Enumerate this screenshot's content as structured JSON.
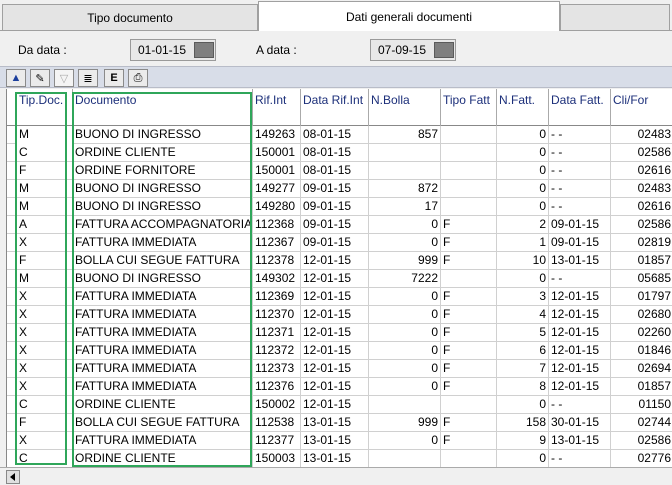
{
  "tabs": [
    {
      "label": "Tipo documento"
    },
    {
      "label": "Dati generali documenti"
    },
    {
      "label": ""
    }
  ],
  "filter": {
    "from_label": "Da data :",
    "from_value": "01-01-15",
    "to_label": "A data :",
    "to_value": "07-09-15"
  },
  "toolbar": [
    {
      "icon": "up-arrow-icon",
      "glyph": "▲"
    },
    {
      "icon": "edit-icon",
      "glyph": "✎"
    },
    {
      "icon": "filter-icon",
      "glyph": "▽"
    },
    {
      "icon": "list-icon",
      "glyph": "≣"
    },
    {
      "icon": "excel-export-icon",
      "glyph": "E"
    },
    {
      "icon": "print-icon",
      "glyph": "⎙"
    }
  ],
  "columns": [
    "Tip.Doc.",
    "Documento",
    "Rif.Int",
    "Data Rif.Int",
    "N.Bolla",
    "Tipo Fatt",
    "N.Fatt.",
    "Data Fatt.",
    "Cli/For"
  ],
  "rows": [
    [
      "M",
      "BUONO DI INGRESSO",
      "149263",
      "08-01-15",
      "857",
      "",
      "0",
      "- -",
      "02483"
    ],
    [
      "C",
      "ORDINE CLIENTE",
      "150001",
      "08-01-15",
      "",
      "",
      "0",
      "- -",
      "02586"
    ],
    [
      "F",
      "ORDINE FORNITORE",
      "150001",
      "08-01-15",
      "",
      "",
      "0",
      "- -",
      "02616"
    ],
    [
      "M",
      "BUONO DI INGRESSO",
      "149277",
      "09-01-15",
      "872",
      "",
      "0",
      "- -",
      "02483"
    ],
    [
      "M",
      "BUONO DI INGRESSO",
      "149280",
      "09-01-15",
      "17",
      "",
      "0",
      "- -",
      "02616"
    ],
    [
      "A",
      "FATTURA ACCOMPAGNATORIA",
      "112368",
      "09-01-15",
      "0",
      "F",
      "2",
      "09-01-15",
      "02586"
    ],
    [
      "X",
      "FATTURA IMMEDIATA",
      "112367",
      "09-01-15",
      "0",
      "F",
      "1",
      "09-01-15",
      "02819"
    ],
    [
      "F",
      "BOLLA CUI SEGUE FATTURA",
      "112378",
      "12-01-15",
      "999",
      "F",
      "10",
      "13-01-15",
      "01857"
    ],
    [
      "M",
      "BUONO DI INGRESSO",
      "149302",
      "12-01-15",
      "7222",
      "",
      "0",
      "- -",
      "05685"
    ],
    [
      "X",
      "FATTURA IMMEDIATA",
      "112369",
      "12-01-15",
      "0",
      "F",
      "3",
      "12-01-15",
      "01797"
    ],
    [
      "X",
      "FATTURA IMMEDIATA",
      "112370",
      "12-01-15",
      "0",
      "F",
      "4",
      "12-01-15",
      "02680"
    ],
    [
      "X",
      "FATTURA IMMEDIATA",
      "112371",
      "12-01-15",
      "0",
      "F",
      "5",
      "12-01-15",
      "02260"
    ],
    [
      "X",
      "FATTURA IMMEDIATA",
      "112372",
      "12-01-15",
      "0",
      "F",
      "6",
      "12-01-15",
      "01846"
    ],
    [
      "X",
      "FATTURA IMMEDIATA",
      "112373",
      "12-01-15",
      "0",
      "F",
      "7",
      "12-01-15",
      "02694"
    ],
    [
      "X",
      "FATTURA IMMEDIATA",
      "112376",
      "12-01-15",
      "0",
      "F",
      "8",
      "12-01-15",
      "01857"
    ],
    [
      "C",
      "ORDINE CLIENTE",
      "150002",
      "12-01-15",
      "",
      "",
      "0",
      "- -",
      "01150"
    ],
    [
      "F",
      "BOLLA CUI SEGUE FATTURA",
      "112538",
      "13-01-15",
      "999",
      "F",
      "158",
      "30-01-15",
      "02744"
    ],
    [
      "X",
      "FATTURA IMMEDIATA",
      "112377",
      "13-01-15",
      "0",
      "F",
      "9",
      "13-01-15",
      "02586"
    ],
    [
      "C",
      "ORDINE CLIENTE",
      "150003",
      "13-01-15",
      "",
      "",
      "0",
      "- -",
      "02776"
    ]
  ],
  "colors": {
    "header_text": "#1c2f7a",
    "highlight": "#2fa65a"
  }
}
